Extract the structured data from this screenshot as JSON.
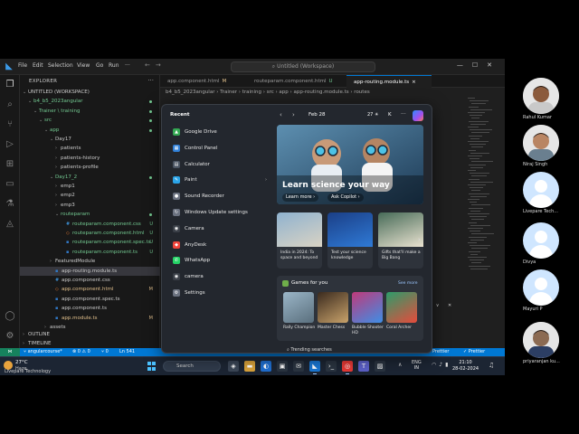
{
  "vscode": {
    "menu": [
      "File",
      "Edit",
      "Selection",
      "View",
      "Go",
      "Run"
    ],
    "menu_more": "···",
    "command_center": "Untitled (Workspace)",
    "explorer": {
      "title": "EXPLORER",
      "more": "···",
      "items": [
        {
          "label": "UNTITLED (WORKSPACE)",
          "indent": 0,
          "chevron": "⌄",
          "color": "default"
        },
        {
          "label": "b4_b5_2023angular",
          "indent": 1,
          "chevron": "⌄",
          "color": "green",
          "dot": true
        },
        {
          "label": "Trainer \\ training",
          "indent": 2,
          "chevron": "⌄",
          "color": "green",
          "dot": true
        },
        {
          "label": "src",
          "indent": 3,
          "chevron": "⌄",
          "color": "green",
          "dot": true
        },
        {
          "label": "app",
          "indent": 4,
          "chevron": "⌄",
          "color": "green",
          "dot": true
        },
        {
          "label": "Day17",
          "indent": 5,
          "chevron": "⌄",
          "color": "default"
        },
        {
          "label": "patients",
          "indent": 6,
          "chevron": "›",
          "color": "default"
        },
        {
          "label": "patients-history",
          "indent": 6,
          "chevron": "›",
          "color": "default"
        },
        {
          "label": "patients-profile",
          "indent": 6,
          "chevron": "›",
          "color": "default"
        },
        {
          "label": "Day17_2",
          "indent": 5,
          "chevron": "⌄",
          "color": "green",
          "dot": true
        },
        {
          "label": "emp1",
          "indent": 6,
          "chevron": "›",
          "color": "default"
        },
        {
          "label": "emp2",
          "indent": 6,
          "chevron": "›",
          "color": "default"
        },
        {
          "label": "emp3",
          "indent": 6,
          "chevron": "›",
          "color": "default"
        },
        {
          "label": "routeparam",
          "indent": 6,
          "chevron": "⌄",
          "color": "green",
          "dot": true
        },
        {
          "label": "routeparam.component.css",
          "indent": 7,
          "chevron": "",
          "color": "green",
          "badge": "U",
          "icon": "#"
        },
        {
          "label": "routeparam.component.html",
          "indent": 7,
          "chevron": "",
          "color": "green",
          "badge": "U",
          "icon": "<>"
        },
        {
          "label": "routeparam.component.spec.ts",
          "indent": 7,
          "chevron": "",
          "color": "green",
          "badge": "U",
          "icon": "TS"
        },
        {
          "label": "routeparam.component.ts",
          "indent": 7,
          "chevron": "",
          "color": "green",
          "badge": "U",
          "icon": "TS"
        },
        {
          "label": "FeaturedModule",
          "indent": 5,
          "chevron": "›",
          "color": "default"
        },
        {
          "label": "app-routing.module.ts",
          "indent": 5,
          "chevron": "",
          "color": "default",
          "icon": "TS",
          "selected": true
        },
        {
          "label": "app.component.css",
          "indent": 5,
          "chevron": "",
          "color": "default",
          "icon": "#"
        },
        {
          "label": "app.component.html",
          "indent": 5,
          "chevron": "",
          "color": "orange",
          "badge": "M",
          "icon": "<>"
        },
        {
          "label": "app.component.spec.ts",
          "indent": 5,
          "chevron": "",
          "color": "default",
          "icon": "TS"
        },
        {
          "label": "app.component.ts",
          "indent": 5,
          "chevron": "",
          "color": "default",
          "icon": "TS"
        },
        {
          "label": "app.module.ts",
          "indent": 5,
          "chevron": "",
          "color": "orange",
          "badge": "M",
          "icon": "TS"
        },
        {
          "label": "assets",
          "indent": 4,
          "chevron": "›",
          "color": "default"
        }
      ],
      "outline": "OUTLINE",
      "timeline": "TIMELINE"
    },
    "tabs": [
      {
        "label": "app.component.html",
        "mod": "M",
        "active": false
      },
      {
        "label": "routeparam.component.html",
        "mod": "U",
        "active": false
      },
      {
        "label": "app-routing.module.ts",
        "mod": "×",
        "active": true
      }
    ],
    "breadcrumb": "b4_b5_2023angular › Trainer › training › src › app › app-routing.module.ts › routes",
    "status": {
      "branch": "angularcourse*",
      "errors": "⊗ 0 ⚠ 0",
      "ports": "⑂ 0",
      "line": "Ln 541",
      "prettier": "Prettier",
      "prettier2": "✓ Prettier"
    }
  },
  "taskbar": {
    "weather_temp": "27°C",
    "weather_desc": "Haze",
    "search_placeholder": "Search",
    "lang": "ENG",
    "lang2": "IN",
    "time": "21:10",
    "date": "28-02-2024"
  },
  "start_menu": {
    "recent_title": "Recent",
    "recent_items": [
      {
        "label": "Google Drive",
        "color": "#34a853",
        "glyph": "▲"
      },
      {
        "label": "Control Panel",
        "color": "#2f7fd7",
        "glyph": "▦"
      },
      {
        "label": "Calculator",
        "color": "#4b5563",
        "glyph": "▤"
      },
      {
        "label": "Paint",
        "color": "#2aa4e8",
        "glyph": "✎"
      },
      {
        "label": "Sound Recorder",
        "color": "#6b7280",
        "glyph": "●"
      },
      {
        "label": "Windows Update settings",
        "color": "#6b7280",
        "glyph": "↻"
      },
      {
        "label": "Camera",
        "color": "#3a3f47",
        "glyph": "◉"
      },
      {
        "label": "AnyDesk",
        "color": "#ef443b",
        "glyph": "◆"
      },
      {
        "label": "WhatsApp",
        "color": "#25d366",
        "glyph": "✆"
      },
      {
        "label": "camera",
        "color": "#3a3f47",
        "glyph": "◉"
      },
      {
        "label": "Settings",
        "color": "#6b7280",
        "glyph": "⚙"
      }
    ],
    "widgets": {
      "date": "Feb 28",
      "temp": "27 ☀",
      "user": "K",
      "more": "···",
      "hero_title": "Learn science your way",
      "hero_learn": "Learn more ›",
      "hero_copilot": "Ask Copilot ›",
      "news": [
        {
          "caption": "India in 2024: To space and beyond",
          "color1": "#8fb2cf",
          "color2": "#d9d3c4"
        },
        {
          "caption": "Test your science knowledge",
          "color1": "#1b3f87",
          "color2": "#2f7ad6"
        },
        {
          "caption": "Gifts that'll make a Big Bang",
          "color1": "#476b58",
          "color2": "#e9e2d0"
        }
      ],
      "games_title": "Games for you",
      "games_see_more": "See more",
      "games": [
        {
          "name": "Rally Champion",
          "color1": "#9bb6c8",
          "color2": "#5a6f7d"
        },
        {
          "name": "Master Chess",
          "color1": "#3a2a1e",
          "color2": "#c9a36b"
        },
        {
          "name": "Bubble Shooter HD",
          "color1": "#c03a7a",
          "color2": "#3e8ee6"
        },
        {
          "name": "Coral Archer",
          "color1": "#2c9c6a",
          "color2": "#e64b3c"
        }
      ],
      "trending": "Trending searches"
    }
  },
  "participants": [
    {
      "name": "Rahul Kumar",
      "type": "photo",
      "skin": "#8b5a3c",
      "shirt": "#c9c9c9"
    },
    {
      "name": "Niraj Singh",
      "type": "photo",
      "skin": "#b98563",
      "shirt": "#6a7f8f"
    },
    {
      "name": "Livepare Tech...",
      "type": "generic"
    },
    {
      "name": "Divya",
      "type": "generic"
    },
    {
      "name": "Mayuri P",
      "type": "generic"
    },
    {
      "name": "priyaranjan ku...",
      "type": "photo",
      "skin": "#8b6a52",
      "shirt": "#2c3e63"
    }
  ],
  "watermark": "Livepare Technology"
}
